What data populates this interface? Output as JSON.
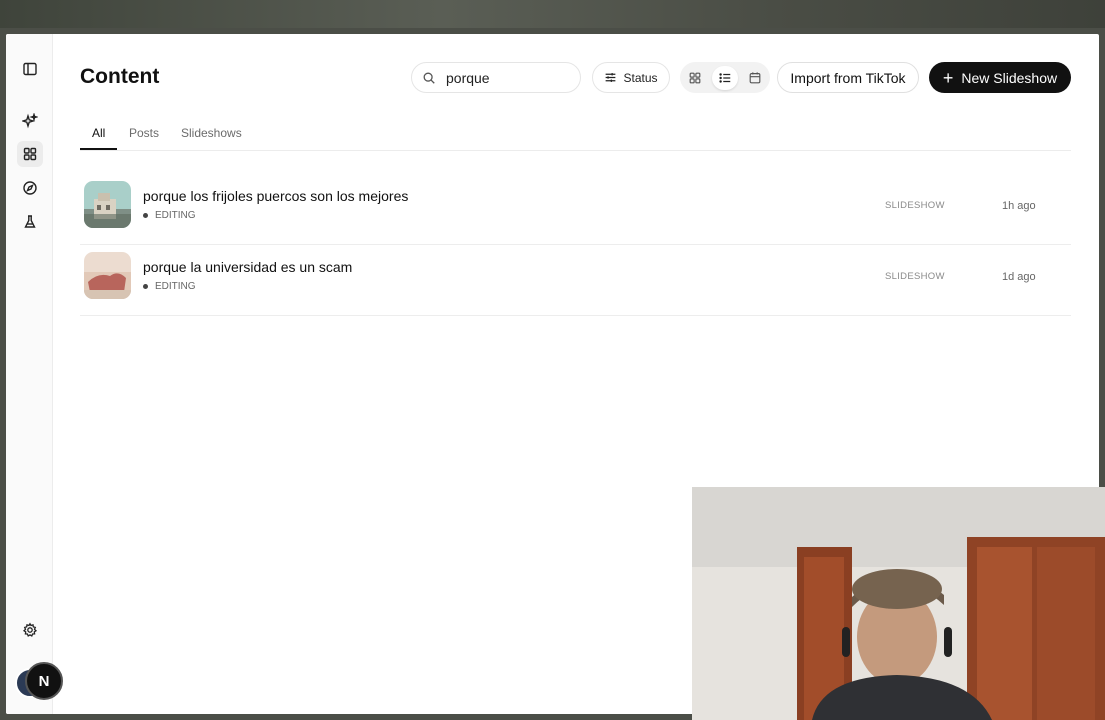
{
  "header": {
    "title": "Content"
  },
  "search": {
    "value": "porque"
  },
  "toolbar": {
    "status_label": "Status",
    "import_label": "Import from TikTok",
    "new_label": "New Slideshow"
  },
  "tabs": [
    {
      "label": "All",
      "active": true
    },
    {
      "label": "Posts",
      "active": false
    },
    {
      "label": "Slideshows",
      "active": false
    }
  ],
  "items": [
    {
      "title": "porque los frijoles puercos son los mejores",
      "status": "EDITING",
      "type": "SLIDESHOW",
      "time": "1h ago"
    },
    {
      "title": "porque la universidad es un scam",
      "status": "EDITING",
      "type": "SLIDESHOW",
      "time": "1d ago"
    }
  ],
  "user": {
    "initial": "N"
  },
  "icons": {
    "sidebar": [
      "sidebar-toggle-icon",
      "sparkles-icon",
      "grid-icon",
      "compass-icon",
      "flask-icon",
      "gear-icon"
    ],
    "toolbar": [
      "search-icon",
      "sliders-icon",
      "grid-view-icon",
      "list-view-icon",
      "calendar-icon",
      "plus-icon"
    ]
  },
  "colors": {
    "primary_button": "#111111",
    "background": "#ffffff"
  }
}
